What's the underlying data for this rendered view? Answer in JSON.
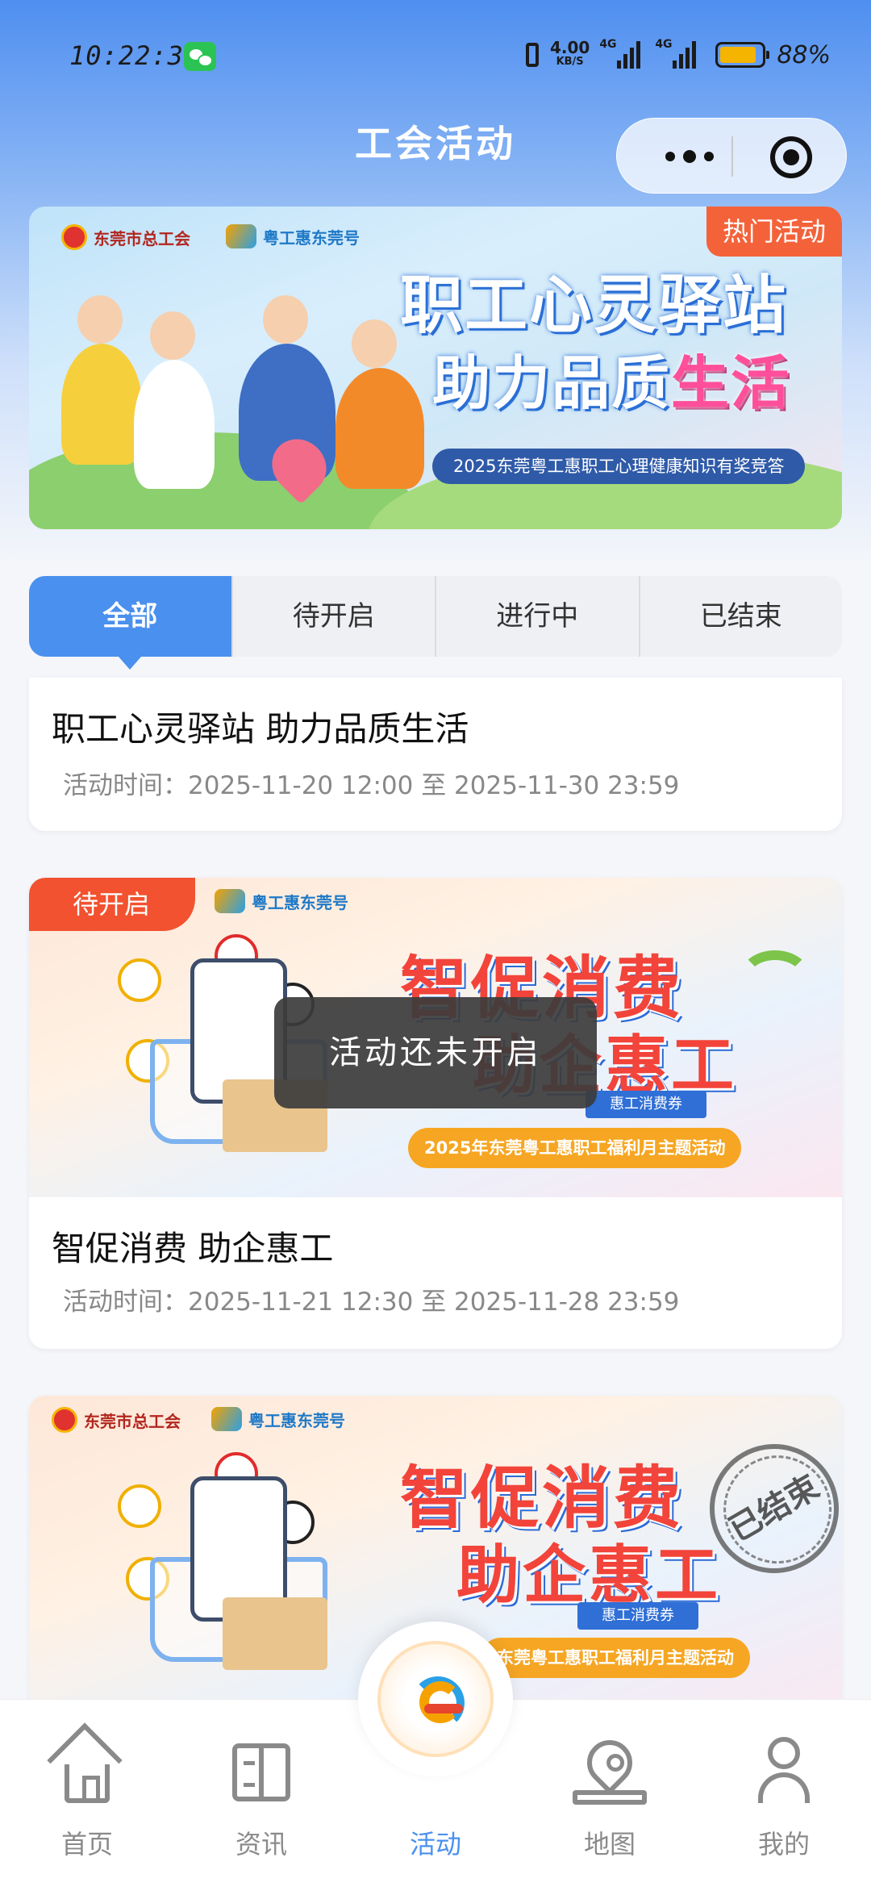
{
  "status_bar": {
    "time": "10:22:31",
    "net_speed": "4.00",
    "net_unit": "KB/S",
    "signal1_label": "4G",
    "signal2_label": "4G",
    "battery_percent": "88%",
    "battery_level": 0.88
  },
  "header": {
    "title": "工会活动"
  },
  "banner": {
    "tag": "热门活动",
    "logo1": "东莞市总工会",
    "logo2": "粤工惠东莞号",
    "headline1": "职工心灵驿站",
    "headline2_prefix": "助力品质",
    "headline2_highlight": "生活",
    "subtitle": "2025东莞粤工惠职工心理健康知识有奖竞答"
  },
  "tabs": [
    {
      "label": "全部",
      "active": true
    },
    {
      "label": "待开启",
      "active": false
    },
    {
      "label": "进行中",
      "active": false
    },
    {
      "label": "已结束",
      "active": false
    }
  ],
  "cards": [
    {
      "title": "职工心灵驿站 助力品质生活",
      "time": "活动时间：2025-11-20 12:00 至 2025-11-30 23:59"
    },
    {
      "status": "待开启",
      "logo": "粤工惠东莞号",
      "headline1": "智促消费",
      "headline2": "助企惠工",
      "badge": "惠工消费券",
      "subtitle": "2025年东莞粤工惠职工福利月主题活动",
      "title": "智促消费 助企惠工",
      "time": "活动时间：2025-11-21 12:30 至 2025-11-28 23:59"
    },
    {
      "logo1": "东莞市总工会",
      "logo2": "粤工惠东莞号",
      "headline1": "智促消费",
      "headline2": "助企惠工",
      "badge": "惠工消费券",
      "subtitle": "东莞粤工惠职工福利月主题活动",
      "stamp": "已结束"
    }
  ],
  "toast": "活动还未开启",
  "bottom_nav": [
    {
      "label": "首页",
      "icon": "home-icon",
      "active": false
    },
    {
      "label": "资讯",
      "icon": "book-icon",
      "active": false
    },
    {
      "label": "活动",
      "icon": "logo-icon",
      "active": true
    },
    {
      "label": "地图",
      "icon": "map-pin-icon",
      "active": false
    },
    {
      "label": "我的",
      "icon": "user-icon",
      "active": false
    }
  ],
  "colors": {
    "accent": "#4a90ee",
    "tag": "#f2522f",
    "inactive": "#8a8a8a"
  }
}
